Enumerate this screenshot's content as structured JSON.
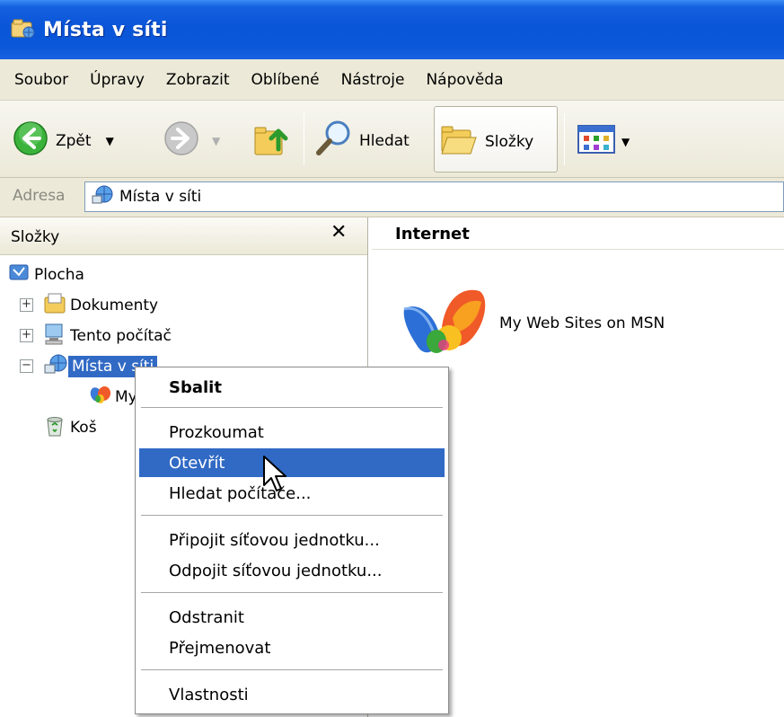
{
  "window": {
    "title": "Místa v síti",
    "title_icon": "network-places-icon"
  },
  "menubar": {
    "items": [
      "Soubor",
      "Úpravy",
      "Zobrazit",
      "Oblíbené",
      "Nástroje",
      "Nápověda"
    ]
  },
  "toolbar": {
    "back_label": "Zpět",
    "search_label": "Hledat",
    "folders_label": "Složky",
    "icons": [
      "back-arrow-icon",
      "forward-arrow-icon",
      "up-folder-icon",
      "search-magnifier-icon",
      "folders-icon",
      "views-icon"
    ]
  },
  "address": {
    "label": "Adresa",
    "value": "Místa v síti"
  },
  "folder_pane": {
    "title": "Složky",
    "close_glyph": "✕",
    "tree": [
      {
        "label": "Plocha",
        "icon": "desktop-icon"
      },
      {
        "label": "Dokumenty",
        "icon": "documents-icon",
        "expander": "+"
      },
      {
        "label": "Tento počítač",
        "icon": "computer-icon",
        "expander": "+"
      },
      {
        "label": "Místa v síti",
        "icon": "network-icon",
        "expander": "−",
        "selected": true
      },
      {
        "label": "My",
        "icon": "msn-butterfly-icon"
      },
      {
        "label": "Koš",
        "icon": "recycle-bin-icon"
      }
    ]
  },
  "content": {
    "group_title": "Internet",
    "items": [
      {
        "label": "My Web Sites on MSN",
        "icon": "msn-butterfly-icon"
      }
    ]
  },
  "context_menu": {
    "items": [
      {
        "label": "Sbalit",
        "bold": true
      },
      {
        "label": "Prozkoumat"
      },
      {
        "label": "Otevřít",
        "hover": true
      },
      {
        "label": "Hledat počítače..."
      },
      {
        "label": "Připojit síťovou jednotku..."
      },
      {
        "label": "Odpojit síťovou jednotku..."
      },
      {
        "label": "Odstranit"
      },
      {
        "label": "Přejmenovat"
      },
      {
        "label": "Vlastnosti"
      }
    ]
  },
  "colors": {
    "titlebar": "#0a55d8",
    "selection": "#316ac5",
    "chrome": "#ece9d8"
  }
}
